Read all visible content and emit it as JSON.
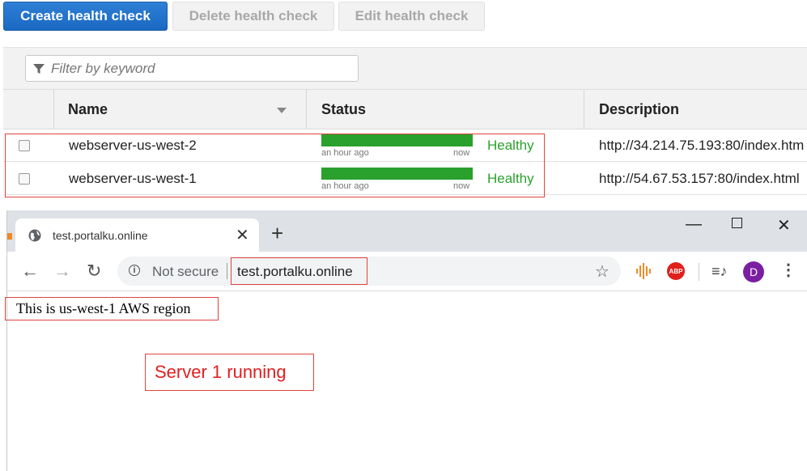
{
  "aws": {
    "buttons": {
      "create": "Create health check",
      "delete": "Delete health check",
      "edit": "Edit health check"
    },
    "filter": {
      "placeholder": "Filter by keyword"
    },
    "columns": {
      "name": "Name",
      "status": "Status",
      "description": "Description"
    },
    "rows": [
      {
        "name": "webserver-us-west-2",
        "status_start": "an hour ago",
        "status_end": "now",
        "health": "Healthy",
        "description": "http://34.214.75.193:80/index.htm"
      },
      {
        "name": "webserver-us-west-1",
        "status_start": "an hour ago",
        "status_end": "now",
        "health": "Healthy",
        "description": "http://54.67.53.157:80/index.html"
      }
    ]
  },
  "browser": {
    "tab_title": "test.portalku.online",
    "security_label": "Not secure",
    "url": "test.portalku.online",
    "avatar_initial": "D",
    "abp_label": "ABP",
    "page_text": "This is us-west-1 AWS region"
  },
  "annotation": {
    "note": "Server 1 running"
  },
  "colors": {
    "primary": "#1a68c2",
    "healthy": "#2aa12c",
    "highlight": "#e0443e",
    "avatar": "#7b1fa2"
  }
}
